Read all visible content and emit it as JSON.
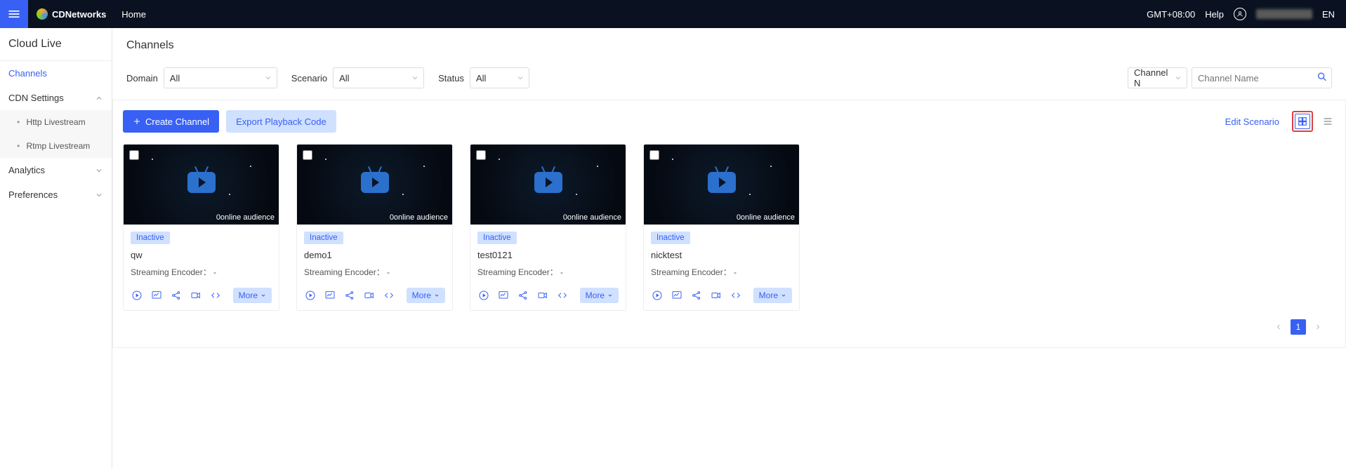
{
  "header": {
    "brand": "CDNetworks",
    "nav_home": "Home",
    "timezone": "GMT+08:00",
    "help": "Help",
    "lang": "EN"
  },
  "sidebar": {
    "product": "Cloud Live",
    "items": {
      "channels": "Channels",
      "cdn_settings": "CDN Settings",
      "http_livestream": "Http Livestream",
      "rtmp_livestream": "Rtmp Livestream",
      "analytics": "Analytics",
      "preferences": "Preferences"
    }
  },
  "page": {
    "title": "Channels"
  },
  "filters": {
    "domain_label": "Domain",
    "domain_value": "All",
    "scenario_label": "Scenario",
    "scenario_value": "All",
    "status_label": "Status",
    "status_value": "All",
    "search_field_value": "Channel N",
    "search_placeholder": "Channel Name"
  },
  "toolbar": {
    "create": "Create Channel",
    "export": "Export Playback Code",
    "edit_scenario": "Edit Scenario"
  },
  "card_common": {
    "audience": "0online audience",
    "encoder_label": "Streaming Encoder：",
    "encoder_value": "-",
    "more": "More"
  },
  "channels": [
    {
      "status": "Inactive",
      "name": "qw"
    },
    {
      "status": "Inactive",
      "name": "demo1"
    },
    {
      "status": "Inactive",
      "name": "test0121"
    },
    {
      "status": "Inactive",
      "name": "nicktest"
    }
  ],
  "pagination": {
    "current": "1"
  }
}
